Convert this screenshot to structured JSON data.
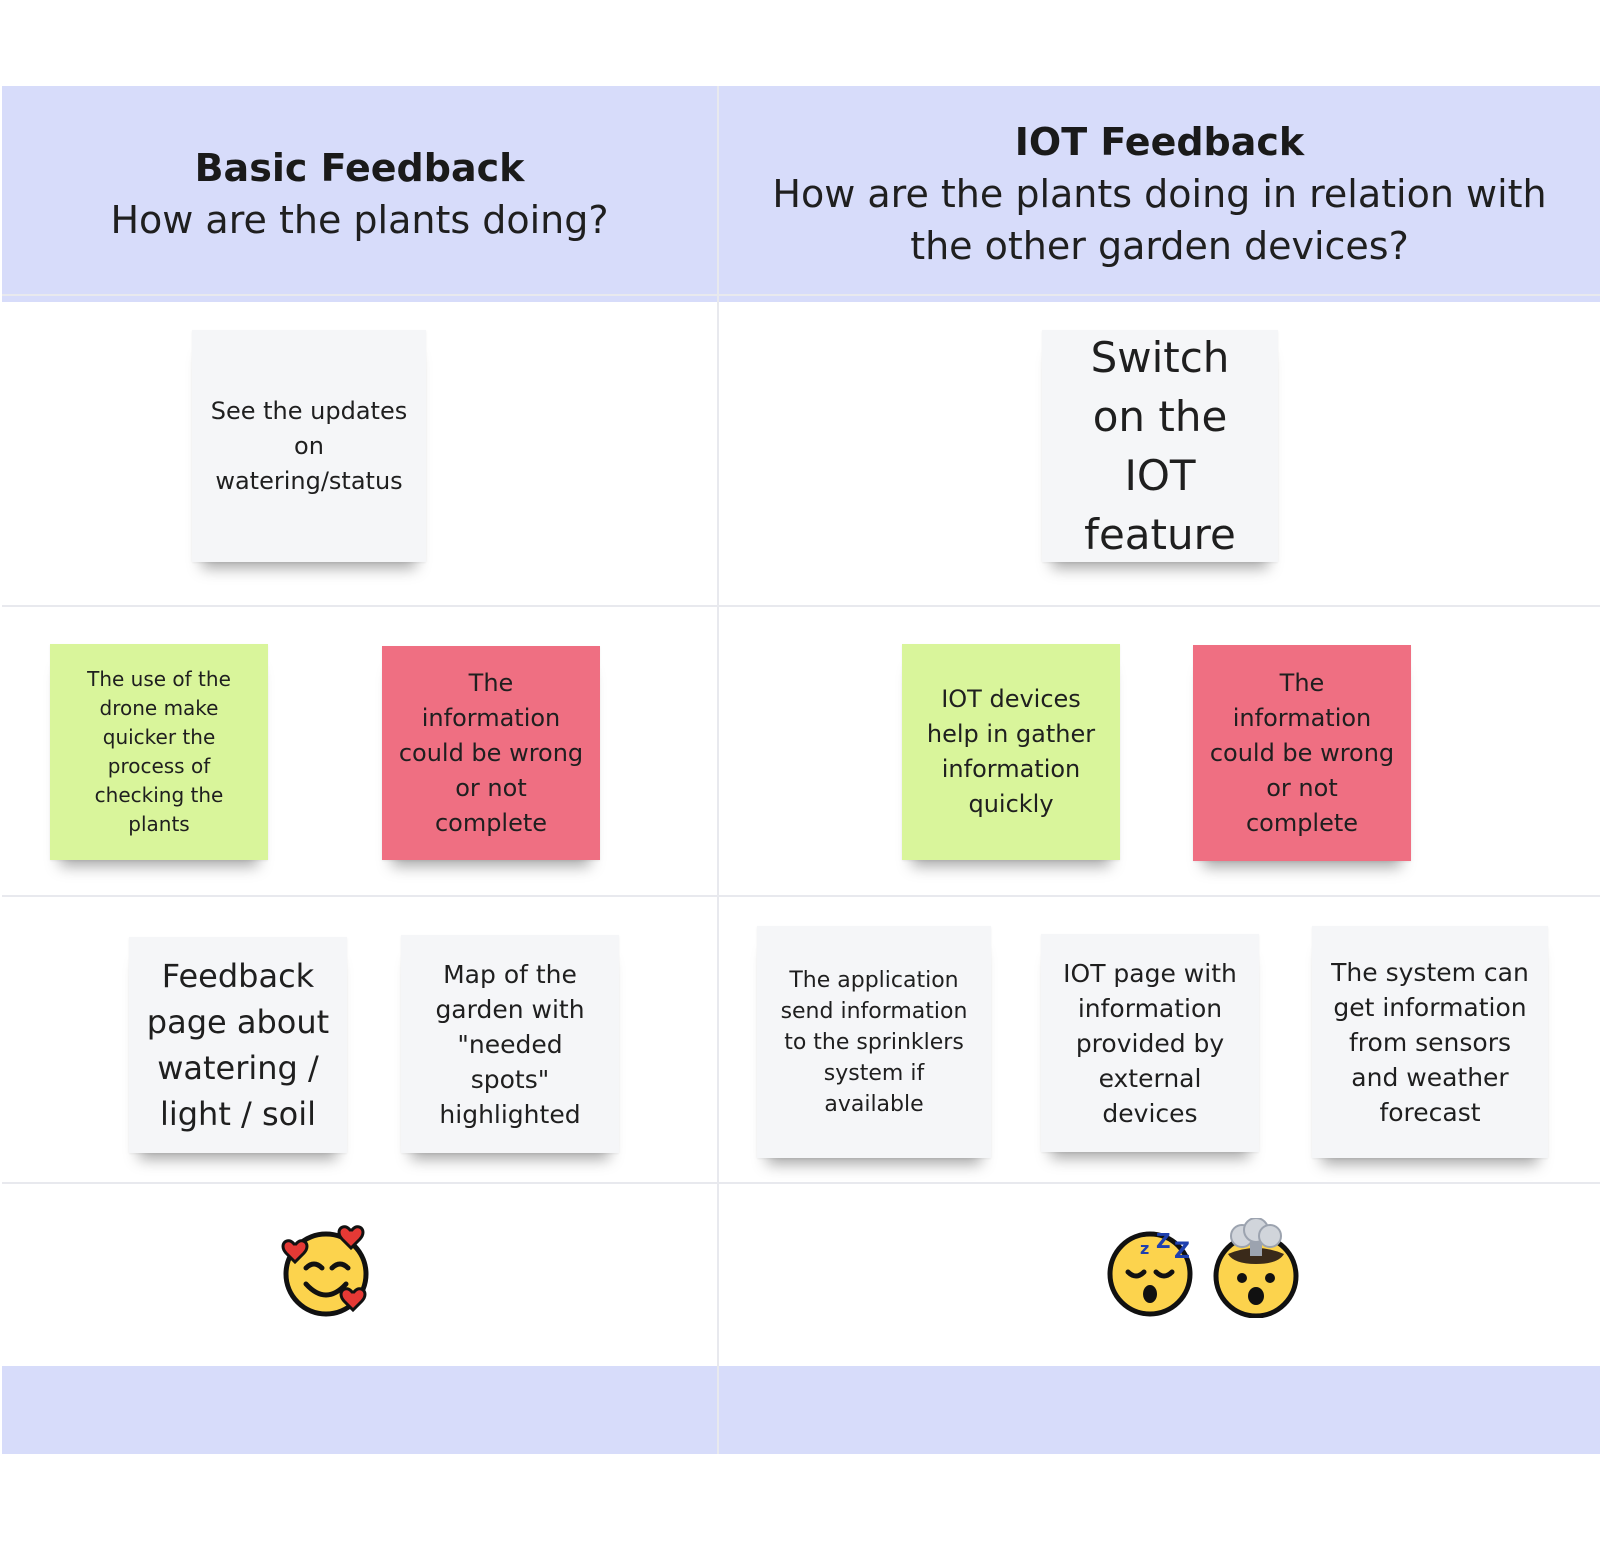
{
  "columns": [
    {
      "title": "Basic Feedback",
      "subtitle": "How are the plants doing?",
      "notes": {
        "top": "See the updates on watering/status",
        "positive": "The use of the drone make quicker the process of checking the plants",
        "negative": "The information could be wrong or not complete",
        "ideas": [
          "Feedback page about watering / light / soil",
          "Map of the garden with \"needed spots\" highlighted"
        ]
      },
      "reactions": [
        "smiling-face-with-hearts"
      ]
    },
    {
      "title": "IOT Feedback",
      "subtitle": "How are the plants doing in relation with the other garden devices?",
      "notes": {
        "top": "Switch on the IOT feature",
        "positive": "IOT devices help in gather information quickly",
        "negative": "The information could be wrong or not complete",
        "ideas": [
          "The application send information to the sprinklers system if available",
          "IOT page with information provided by external devices",
          "The system can get information from sensors and weather forecast"
        ]
      },
      "reactions": [
        "sleeping-face",
        "exploding-head"
      ]
    }
  ],
  "colors": {
    "header_band": "#d7dcfa",
    "note_neutral": "#f5f6f8",
    "note_positive": "#d9f59b",
    "note_negative": "#ef6f82",
    "grid_line": "#e8e9ee"
  }
}
